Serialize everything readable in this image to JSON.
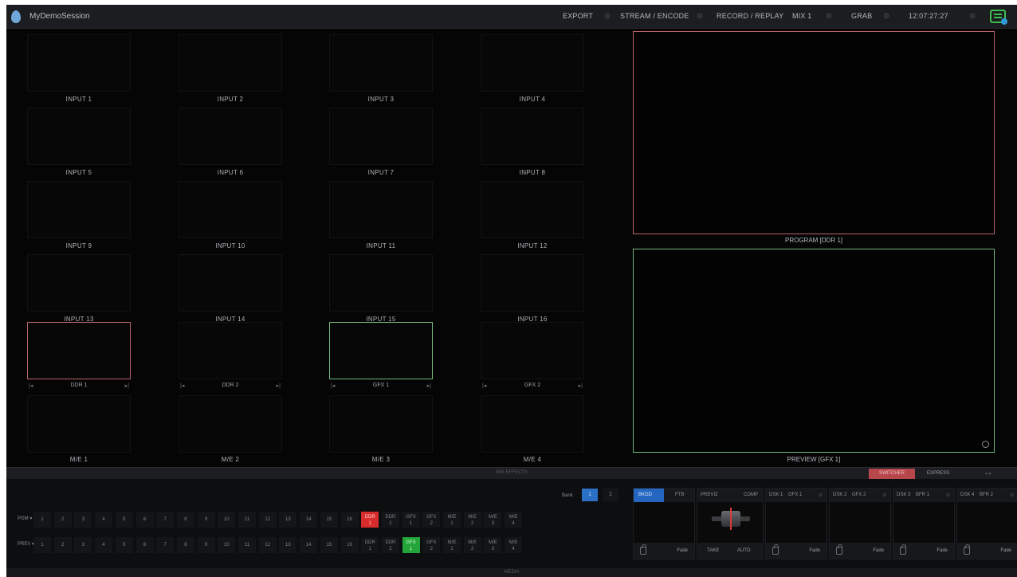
{
  "topbar": {
    "session_name": "MyDemoSession",
    "export": "EXPORT",
    "stream": "STREAM / ENCODE",
    "record": "RECORD / REPLAY",
    "mix": "MIX 1",
    "grab": "GRAB",
    "clock": "12:07:27:27",
    "icons": [
      "tricaster-logo-icon",
      "chat-icon"
    ]
  },
  "inputs": [
    "INPUT 1",
    "INPUT 2",
    "INPUT 3",
    "INPUT 4",
    "INPUT 5",
    "INPUT 6",
    "INPUT 7",
    "INPUT 8",
    "INPUT 9",
    "INPUT 10",
    "INPUT 11",
    "INPUT 12",
    "INPUT 13",
    "INPUT 14",
    "INPUT 15",
    "INPUT 16"
  ],
  "media": [
    "DDR 1",
    "DDR 2",
    "GFX 1",
    "GFX 2"
  ],
  "mes": [
    "M/E 1",
    "M/E 2",
    "M/E 3",
    "M/E 4"
  ],
  "monitors": {
    "program": "PROGRAM [DDR 1]",
    "preview": "PREVIEW [GFX 1]"
  },
  "tabs": {
    "me_effects": "M/E EFFECTS",
    "switcher": "SWITCHER",
    "express": "EXPRESS",
    "media": "MEDIA"
  },
  "switcher": {
    "bank_label": "Bank",
    "banks": [
      "1",
      "2"
    ],
    "pgm_label": "PGM ▾",
    "prev_label": "PREV ▾",
    "pgm_buttons": [
      "1",
      "2",
      "3",
      "4",
      "5",
      "6",
      "7",
      "8",
      "9",
      "10",
      "11",
      "12",
      "13",
      "14",
      "15",
      "16",
      "DDR 1",
      "DDR 2",
      "GFX 1",
      "GFX 2",
      "M/E 1",
      "M/E 2",
      "M/E 3",
      "M/E 4"
    ],
    "prev_buttons": [
      "1",
      "2",
      "3",
      "4",
      "5",
      "6",
      "7",
      "8",
      "9",
      "10",
      "11",
      "12",
      "13",
      "14",
      "15",
      "16",
      "DDR 1",
      "DDR 2",
      "GFX 1",
      "GFX 2",
      "M/E 1",
      "M/E 2",
      "M/E 3",
      "M/E 4"
    ],
    "bgd": "BKGD",
    "ftb": "FTB",
    "prevz": "PREVIZ",
    "comp": "COMP",
    "take": "TAKE",
    "auto": "AUTO",
    "dsks": [
      {
        "name": "DSK 1",
        "source": "GFX 1"
      },
      {
        "name": "DSK 2",
        "source": "GFX 2"
      },
      {
        "name": "DSK 3",
        "source": "BFR 1"
      },
      {
        "name": "DSK 4",
        "source": "BFR 2"
      }
    ],
    "fade": "Fade",
    "colors": {
      "program": "#d82b2b",
      "preview": "#23a53a",
      "bank_active": "#2b6fc6"
    }
  }
}
